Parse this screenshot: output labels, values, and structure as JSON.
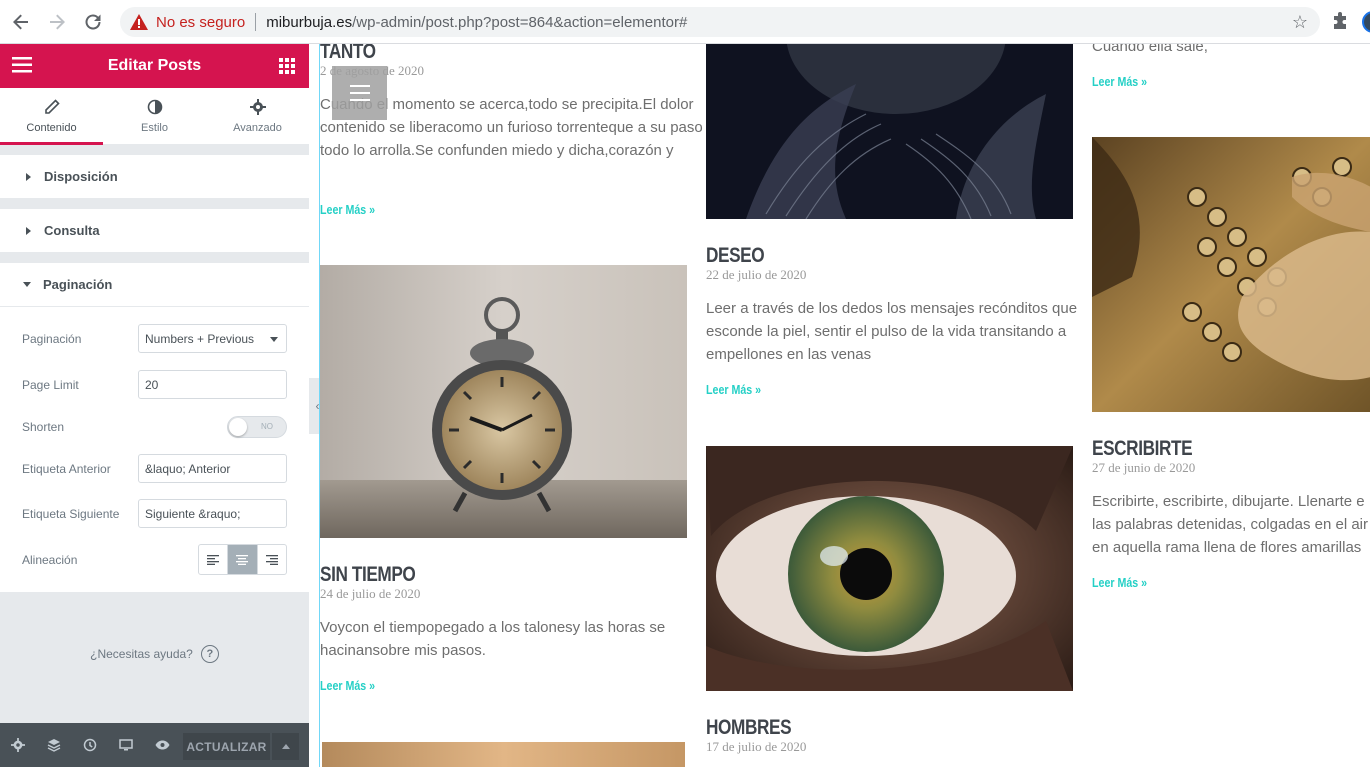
{
  "browser": {
    "insecure_label": "No es seguro",
    "url_host": "miburbuja.es",
    "url_path": "/wp-admin/post.php?post=864&action=elementor#"
  },
  "panel": {
    "title": "Editar Posts",
    "tabs": [
      {
        "label": "Contenido",
        "icon": "pencil-icon"
      },
      {
        "label": "Estilo",
        "icon": "contrast-icon"
      },
      {
        "label": "Avanzado",
        "icon": "gear-icon"
      }
    ],
    "sections": [
      "Disposición",
      "Consulta",
      "Paginación"
    ],
    "controls": {
      "pagination_label": "Paginación",
      "pagination_value": "Numbers + Previous",
      "page_limit_label": "Page Limit",
      "page_limit_value": "20",
      "shorten_label": "Shorten",
      "shorten_value": "NO",
      "prev_label_label": "Etiqueta Anterior",
      "prev_label_value": "&laquo; Anterior",
      "next_label_label": "Etiqueta Siguiente",
      "next_label_value": "Siguiente &raquo;",
      "align_label": "Alineación",
      "align_selected": "center"
    },
    "help": "¿Necesitas ayuda?",
    "help_icon": "?",
    "update_button": "ACTUALIZAR"
  },
  "posts": {
    "p1": {
      "title": "TANTO",
      "date": "2 de agosto de 2020",
      "excerpt": "Cuando el momento se acerca,todo se precipita.El dolor contenido se liberacomo un furioso torrenteque a su paso todo lo arrolla.Se confunden miedo y dicha,corazón y",
      "more": "Leer Más »"
    },
    "p2": {
      "title": "SIN TIEMPO",
      "date": "24 de julio de 2020",
      "excerpt": "Voycon el tiempopegado a los talonesy las horas se hacinansobre mis pasos.",
      "more": "Leer Más »"
    },
    "p3": {
      "title": "DESEO",
      "date": "22 de julio de 2020",
      "excerpt": "Leer a través de los dedos los mensajes recónditos que esconde la piel, sentir el pulso de la vida transitando a empellones en las venas",
      "more": "Leer Más »"
    },
    "p4": {
      "title": "HOMBRES",
      "date": "17 de julio de 2020"
    },
    "p5": {
      "excerpt_tail": "Cuando ella sale,",
      "more": "Leer Más »"
    },
    "p6": {
      "title": "ESCRIBIRTE",
      "date": "27 de junio de 2020",
      "excerpt": "Escribirte, escribirte, dibujarte. Llenarte e las palabras detenidas, colgadas en el air en aquella rama llena de flores amarillas",
      "more": "Leer Más »"
    }
  },
  "colors": {
    "elementor_pink": "#d5144f",
    "read_more": "#25d0c6",
    "panel_dark": "#495157"
  }
}
